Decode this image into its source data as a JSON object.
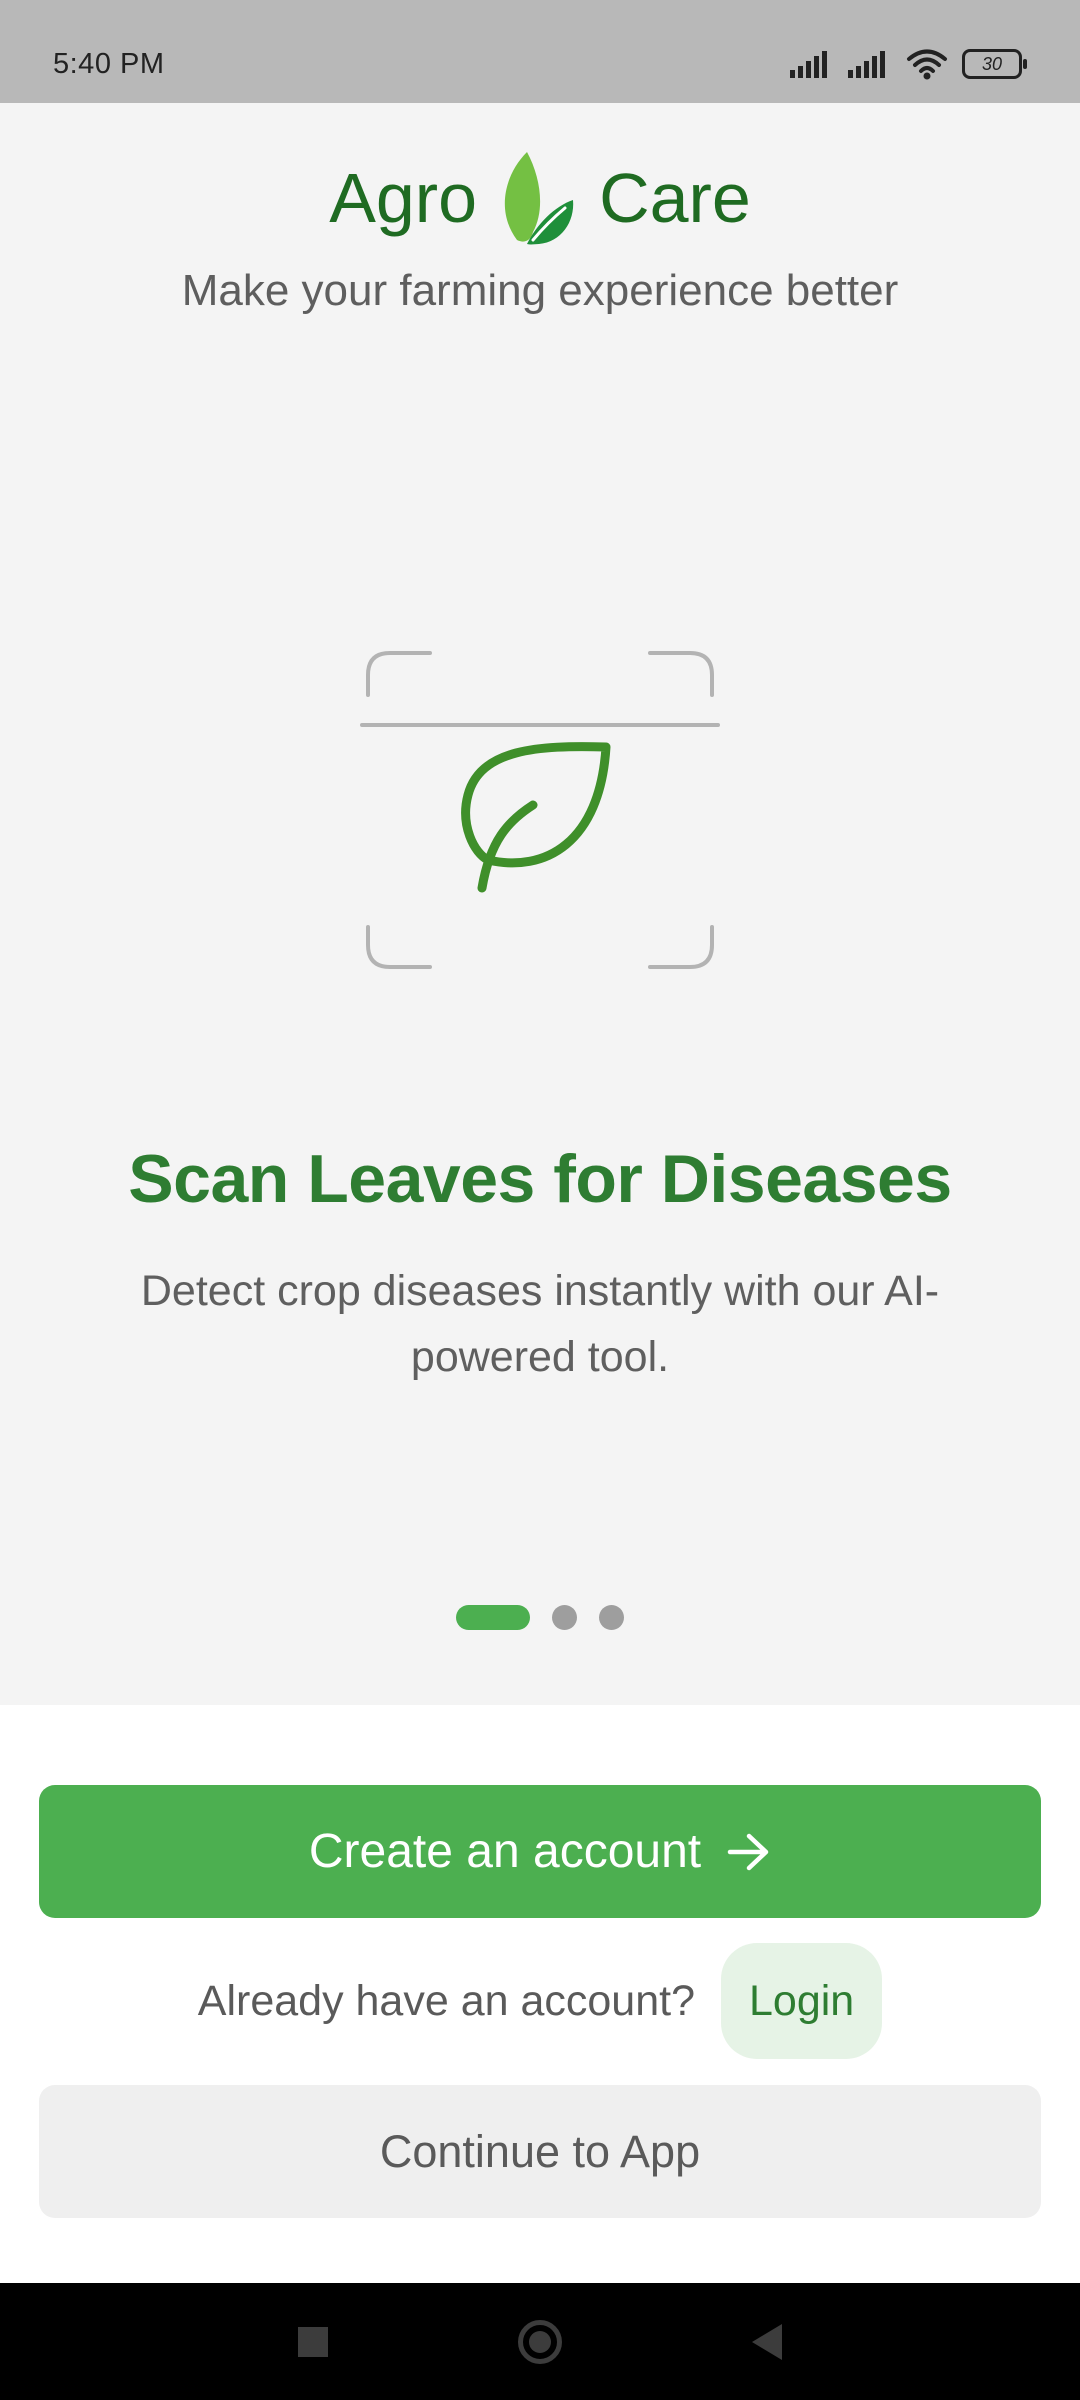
{
  "status_bar": {
    "time": "5:40 PM",
    "battery": "30",
    "icons": [
      "signal-icon",
      "signal-icon",
      "wifi-icon",
      "battery-icon"
    ]
  },
  "header": {
    "brand_left": "Agro",
    "brand_right": "Care",
    "tagline": "Make your farming experience better"
  },
  "slide": {
    "illustration": "scan-leaf-icon",
    "title": "Scan Leaves for Diseases",
    "description": "Detect crop diseases instantly with our AI-powered tool.",
    "pages": 3,
    "active_page": 1
  },
  "actions": {
    "create_account": "Create an account",
    "login_prompt": "Already have an account?",
    "login": "Login",
    "continue": "Continue to App"
  },
  "nav_bar": {
    "icons": [
      "recents-icon",
      "home-icon",
      "back-icon"
    ]
  },
  "colors": {
    "brand_green": "#1f6b22",
    "accent_green": "#4caf50",
    "title_green": "#2e7d32"
  }
}
